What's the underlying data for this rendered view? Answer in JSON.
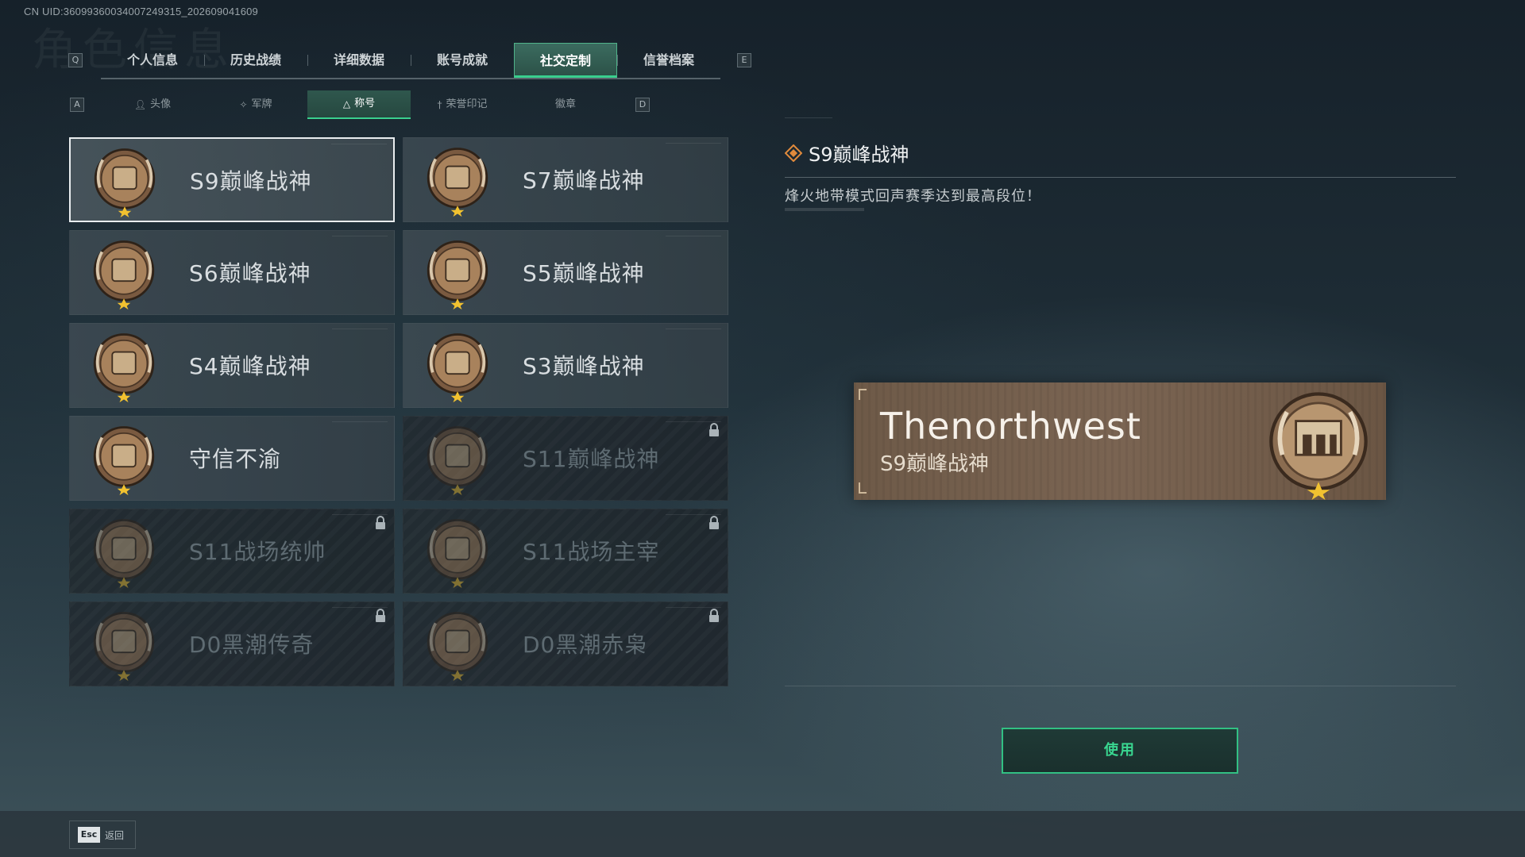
{
  "uid": "CN UID:360993600340072493​15_202609041609",
  "page_heading_ghost": "角色信息",
  "keys": {
    "prev_tab": "Q",
    "next_tab": "E",
    "prev_sub": "A",
    "next_sub": "D"
  },
  "main_tabs": [
    {
      "label": "个人信息"
    },
    {
      "label": "历史战绩"
    },
    {
      "label": "详细数据"
    },
    {
      "label": "账号成就"
    },
    {
      "label": "社交定制",
      "active": true
    },
    {
      "label": "信誉档案"
    }
  ],
  "sub_tabs": [
    {
      "label": "头像",
      "icon": "person-icon"
    },
    {
      "label": "军牌",
      "icon": "dogtag-icon"
    },
    {
      "label": "称号",
      "icon": "title-icon",
      "active": true
    },
    {
      "label": "荣誉印记",
      "icon": "honor-mark-icon"
    },
    {
      "label": "徽章",
      "icon": ""
    }
  ],
  "titles": [
    {
      "label": "S9巅峰战神",
      "emblem": "fortress-emblem",
      "selected": true,
      "locked": false
    },
    {
      "label": "S7巅峰战神",
      "emblem": "rifle-emblem",
      "locked": false
    },
    {
      "label": "S6巅峰战神",
      "emblem": "shield-t-emblem",
      "locked": false
    },
    {
      "label": "S5巅峰战神",
      "emblem": "diver-skull-emblem",
      "locked": false
    },
    {
      "label": "S4巅峰战神",
      "emblem": "helmet-emblem",
      "locked": false
    },
    {
      "label": "S3巅峰战神",
      "emblem": "globe-emblem",
      "locked": false
    },
    {
      "label": "守信不渝",
      "emblem": "scales-emblem",
      "locked": false
    },
    {
      "label": "S11巅峰战神",
      "emblem": "tank-emblem",
      "locked": true
    },
    {
      "label": "S11战场统帅",
      "emblem": "apc-emblem",
      "locked": true
    },
    {
      "label": "S11战场主宰",
      "emblem": "arch-emblem",
      "locked": true
    },
    {
      "label": "D0黑潮传奇",
      "emblem": "hooded-emblem",
      "locked": true
    },
    {
      "label": "D0黑潮赤枭",
      "emblem": "mask-emblem",
      "locked": true
    }
  ],
  "detail": {
    "title": "S9巅峰战神",
    "description": "烽火地带模式回声赛季达到最高段位！"
  },
  "preview": {
    "player_name": "Thenorthwest",
    "title": "S9巅峰战神"
  },
  "actions": {
    "use_label": "使用"
  },
  "footer": {
    "esc_key": "Esc",
    "back_label": "返回"
  },
  "colors": {
    "accent_green": "#39d08e",
    "plate_brown": "#7a6452",
    "emblem_bronze": "#a8825c"
  }
}
